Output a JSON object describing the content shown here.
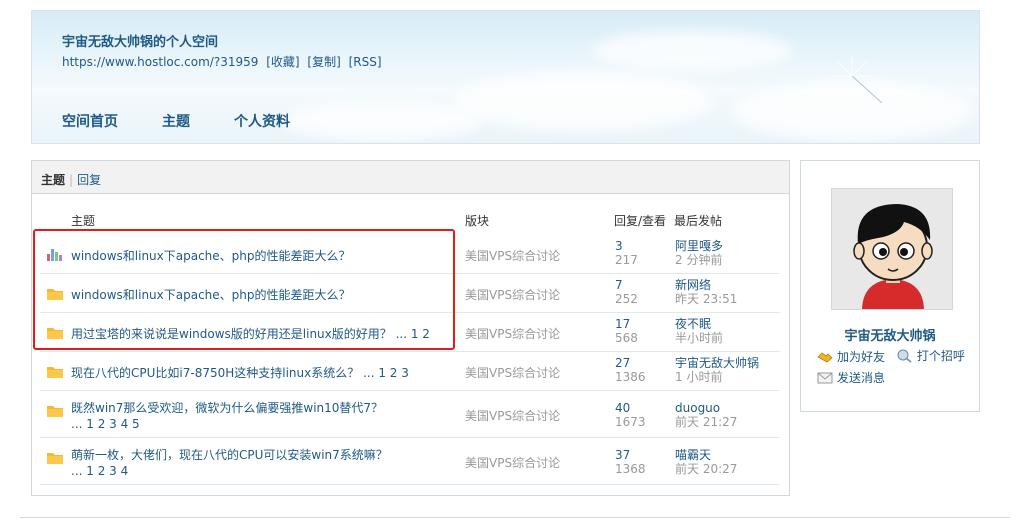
{
  "banner": {
    "title": "宇宙无敌大帅锅的个人空间",
    "url": "https://www.hostloc.com/?31959",
    "link_fav": "[收藏]",
    "link_copy": "[复制]",
    "link_rss": "[RSS]",
    "nav": [
      "空间首页",
      "主题",
      "个人资料"
    ]
  },
  "tabs": {
    "active": "主题",
    "sep": "|",
    "other": "回复"
  },
  "table_headers": {
    "subject": "主题",
    "forum": "版块",
    "replies_views": "回复/查看",
    "last_post": "最后发帖"
  },
  "rows": [
    {
      "title": "windows和linux下apache、php的性能差距大么？",
      "pages": "",
      "forum": "美国VPS综合讨论",
      "replies": "3",
      "views": "217",
      "last_user": "阿里嘎多",
      "last_time": "2 分钟前",
      "icon": "poll-icon"
    },
    {
      "title": "windows和linux下apache、php的性能差距大么？",
      "pages": "",
      "forum": "美国VPS综合讨论",
      "replies": "7",
      "views": "252",
      "last_user": "新网络",
      "last_time": "昨天 23:51",
      "icon": "folder-icon"
    },
    {
      "title": "用过宝塔的来说说是windows版的好用还是linux版的好用？",
      "pages": "...   1   2",
      "forum": "美国VPS综合讨论",
      "replies": "17",
      "views": "568",
      "last_user": "夜不眠",
      "last_time": "半小时前",
      "icon": "folder-icon"
    },
    {
      "title": "现在八代的CPU比如i7-8750H这种支持linux系统么？",
      "pages": "...   1   2   3",
      "forum": "美国VPS综合讨论",
      "replies": "27",
      "views": "1386",
      "last_user": "宇宙无敌大帅锅",
      "last_time": "1 小时前",
      "icon": "folder-icon"
    },
    {
      "title": "既然win7那么受欢迎，微软为什么偏要强推win10替代7？",
      "pages2": "...   1   2   3   4   5",
      "forum": "美国VPS综合讨论",
      "replies": "40",
      "views": "1673",
      "last_user": "duoguo",
      "last_time": "前天 21:27",
      "icon": "folder-icon"
    },
    {
      "title": "萌新一枚，大佬们，现在八代的CPU可以安装win7系统嘛？",
      "pages2": "...   1   2   3   4",
      "forum": "美国VPS综合讨论",
      "replies": "37",
      "views": "1368",
      "last_user": "喵霸天",
      "last_time": "前天 20:27",
      "icon": "folder-icon"
    }
  ],
  "profile": {
    "name": "宇宙无敌大帅锅",
    "add_friend": "加为好友",
    "greet": "打个招呼",
    "message": "发送消息"
  },
  "colors": {
    "link": "#1f5a86",
    "muted": "#999999",
    "highlight": "#e21b1b"
  }
}
